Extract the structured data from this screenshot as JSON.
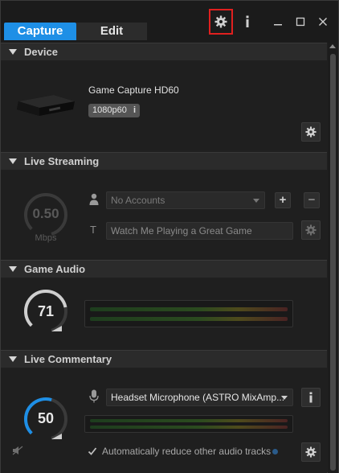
{
  "tabs": {
    "capture": "Capture",
    "edit": "Edit"
  },
  "sections": {
    "device": "Device",
    "live_streaming": "Live Streaming",
    "game_audio": "Game Audio",
    "live_commentary": "Live Commentary"
  },
  "device": {
    "name": "Game Capture HD60",
    "resolution": "1080p60",
    "info_glyph": "i"
  },
  "live_streaming": {
    "bitrate_value": "0.50",
    "bitrate_unit": "Mbps",
    "account_placeholder": "No Accounts",
    "title_placeholder": "Watch Me Playing a Great Game",
    "add_label": "+",
    "remove_label": "−",
    "title_glyph": "T"
  },
  "game_audio": {
    "volume": "71",
    "volume_level": 0.71
  },
  "live_commentary": {
    "volume": "50",
    "volume_level": 0.5,
    "microphone": "Headset Microphone (ASTRO MixAmp...",
    "auto_reduce_label": "Automatically reduce other audio tracks",
    "auto_reduce_checked": true
  },
  "colors": {
    "accent": "#1e8fe6",
    "highlight": "#e0201f",
    "gauge_idle": "#555555"
  },
  "icons": [
    "gear-icon",
    "info-icon",
    "minimize-icon",
    "maximize-icon",
    "close-icon",
    "user-icon",
    "text-icon",
    "microphone-icon",
    "muted-speaker-icon"
  ]
}
